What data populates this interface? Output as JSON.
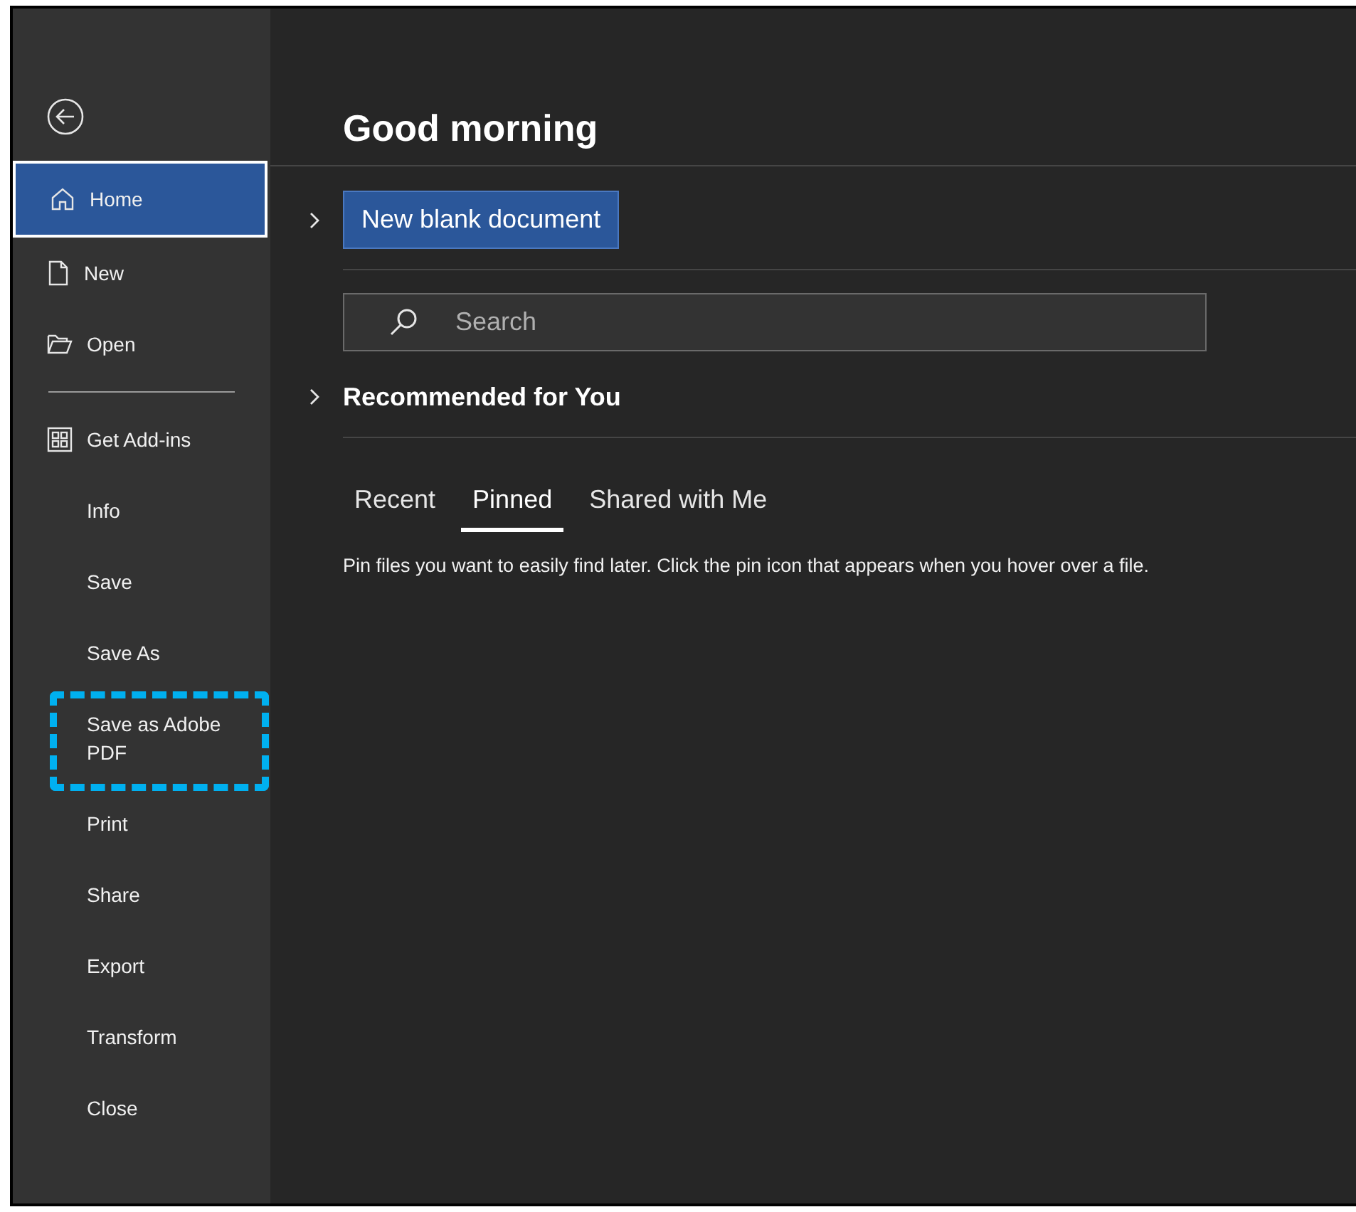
{
  "sidebar": {
    "items": [
      {
        "label": "Home",
        "selected": true,
        "highlighted": false
      },
      {
        "label": "New",
        "selected": false,
        "highlighted": false
      },
      {
        "label": "Open",
        "selected": false,
        "highlighted": false
      },
      {
        "kind": "divider"
      },
      {
        "label": "Get Add-ins",
        "selected": false,
        "highlighted": false
      },
      {
        "label": "Info",
        "selected": false,
        "highlighted": false
      },
      {
        "label": "Save",
        "selected": false,
        "highlighted": false
      },
      {
        "label": "Save As",
        "selected": false,
        "highlighted": false
      },
      {
        "label": "Save as Adobe PDF",
        "selected": false,
        "highlighted": true
      },
      {
        "label": "Print",
        "selected": false,
        "highlighted": false
      },
      {
        "label": "Share",
        "selected": false,
        "highlighted": false
      },
      {
        "label": "Export",
        "selected": false,
        "highlighted": false
      },
      {
        "label": "Transform",
        "selected": false,
        "highlighted": false
      },
      {
        "label": "Close",
        "selected": false,
        "highlighted": false
      }
    ]
  },
  "greeting": "Good morning",
  "new_button": "New blank document",
  "search": {
    "placeholder": "Search"
  },
  "recommended": "Recommended for You",
  "tabs": [
    {
      "label": "Recent",
      "selected": false
    },
    {
      "label": "Pinned",
      "selected": true
    },
    {
      "label": "Shared with Me",
      "selected": false
    }
  ],
  "message": "Pin files you want to easily find later. Click the pin icon that appears when you hover over a file."
}
